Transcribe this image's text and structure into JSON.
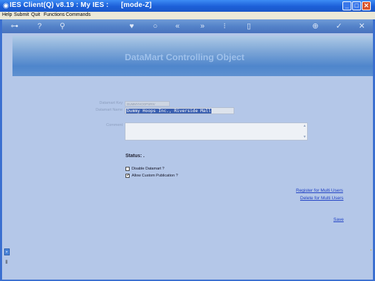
{
  "window": {
    "title": "IES Client(Q) v8.19 : My IES :      [mode-Z]"
  },
  "menu": [
    "Help",
    "Submit",
    "Quit",
    "Functions",
    "Commands"
  ],
  "toolbar": {
    "icons": [
      "key-icon",
      "help-icon",
      "search-icon",
      "heart-icon",
      "circle-icon",
      "rewind-icon",
      "fast-forward-icon",
      "list-icon",
      "page-icon",
      "add-icon",
      "check-icon",
      "close-icon"
    ]
  },
  "page": {
    "title": "DataMart Controlling Object"
  },
  "form": {
    "key_label": "Datamart Key",
    "key_value": "DUMMYHOOPSRIV",
    "name_label": "Datamart Name",
    "name_value": "Dummy Hoops Inc., Riverside Mall",
    "comment_label": "Comment",
    "comment_value": ""
  },
  "status": {
    "label": "Status: ."
  },
  "options": [
    {
      "label": "Disable Datamart ?",
      "checked": false
    },
    {
      "label": "Allow Custom Publication ?",
      "checked": true
    }
  ],
  "links": {
    "register": "Register for Multi Users",
    "delete": "Delete for Multi Users",
    "save": "Save"
  }
}
